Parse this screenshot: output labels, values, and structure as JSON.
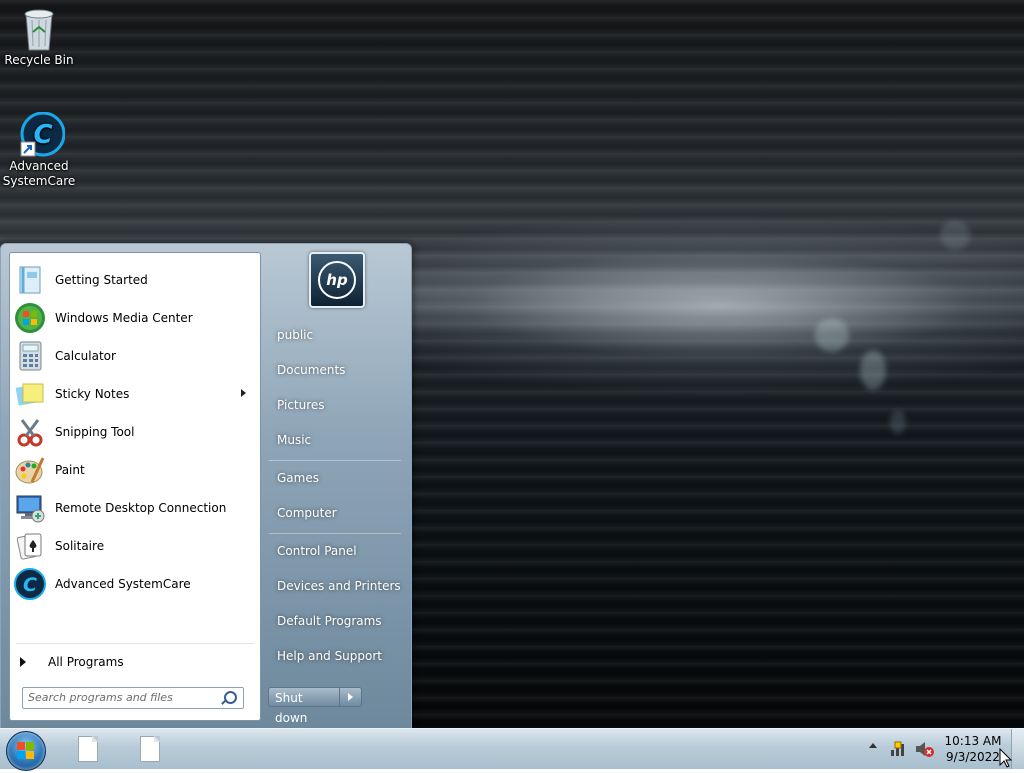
{
  "desktop": {
    "icons": [
      {
        "label": "Recycle Bin",
        "icon": "recycle-bin-icon"
      },
      {
        "label": "Advanced SystemCare",
        "icon": "advanced-systemcare-icon"
      }
    ]
  },
  "start_menu": {
    "programs": [
      {
        "label": "Getting Started",
        "icon": "getting-started-icon"
      },
      {
        "label": "Windows Media Center",
        "icon": "windows-media-center-icon"
      },
      {
        "label": "Calculator",
        "icon": "calculator-icon"
      },
      {
        "label": "Sticky Notes",
        "icon": "sticky-notes-icon",
        "has_submenu": true
      },
      {
        "label": "Snipping Tool",
        "icon": "snipping-tool-icon"
      },
      {
        "label": "Paint",
        "icon": "paint-icon"
      },
      {
        "label": "Remote Desktop Connection",
        "icon": "remote-desktop-icon"
      },
      {
        "label": "Solitaire",
        "icon": "solitaire-icon"
      },
      {
        "label": "Advanced SystemCare",
        "icon": "advanced-systemcare-icon"
      }
    ],
    "all_programs": "All Programs",
    "search_placeholder": "Search programs and files",
    "user_picture": "hp",
    "right_items": [
      {
        "label": "public"
      },
      {
        "label": "Documents"
      },
      {
        "label": "Pictures"
      },
      {
        "label": "Music"
      },
      {
        "label": "Games"
      },
      {
        "label": "Computer"
      },
      {
        "label": "Control Panel"
      },
      {
        "label": "Devices and Printers"
      },
      {
        "label": "Default Programs"
      },
      {
        "label": "Help and Support"
      }
    ],
    "shutdown_label": "Shut down"
  },
  "taskbar": {
    "clock_time": "10:13 AM",
    "clock_date": "9/3/2022",
    "tray_icons": [
      "show-hidden-icons-icon",
      "network-icon",
      "volume-muted-icon"
    ]
  },
  "colors": {
    "taskbar": "#b8cbd8",
    "start_menu_right": "#8ea5b7",
    "selection_accent": "#2b74b6"
  }
}
